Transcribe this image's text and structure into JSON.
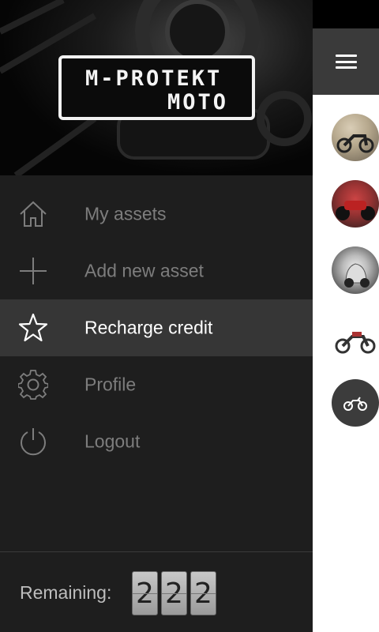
{
  "brand": {
    "line1": "M-PROTEKT",
    "line2": "MOTO"
  },
  "menu": {
    "items": [
      {
        "label": "My assets",
        "icon": "home-icon",
        "active": false
      },
      {
        "label": "Add new asset",
        "icon": "plus-icon",
        "active": false
      },
      {
        "label": "Recharge credit",
        "icon": "star-icon",
        "active": true
      },
      {
        "label": "Profile",
        "icon": "gear-icon",
        "active": false
      },
      {
        "label": "Logout",
        "icon": "power-icon",
        "active": false
      }
    ]
  },
  "footer": {
    "remaining_label": "Remaining:",
    "digits": [
      "2",
      "2",
      "2"
    ]
  },
  "assets": {
    "thumbnails": [
      "motorcycle-photo-1",
      "motorcycle-photo-2",
      "scooter-photo",
      "motorcycle-photo-3",
      "motorcycle-icon"
    ]
  },
  "colors": {
    "drawer_bg": "#1e1e1e",
    "active_item_bg": "#363636",
    "inactive_text": "#7d7d7d",
    "active_text": "#ffffff",
    "appbar_bg": "#3a3a3a"
  }
}
